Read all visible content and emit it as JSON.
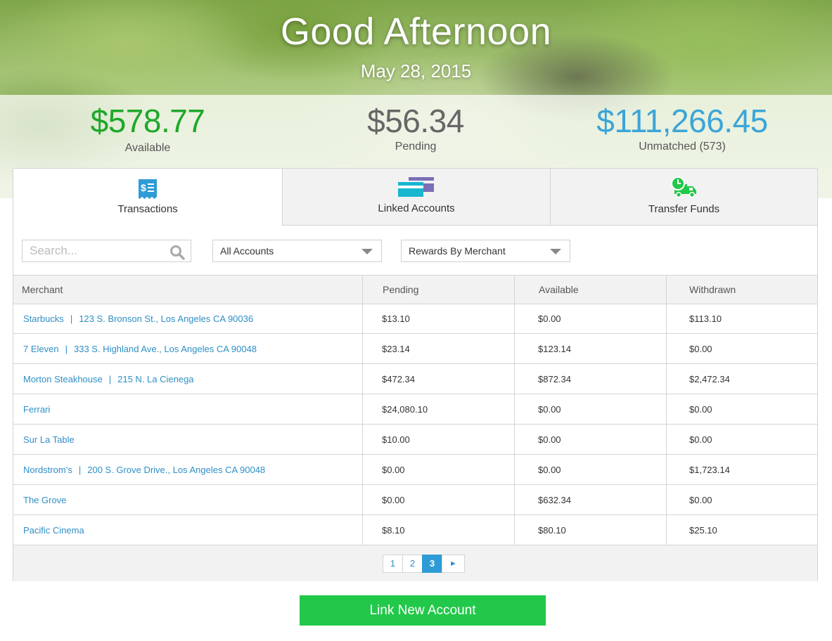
{
  "header": {
    "greeting": "Good Afternoon",
    "date": "May 28, 2015"
  },
  "summary": {
    "available": {
      "amount": "$578.77",
      "label": "Available",
      "color": "#1ea829"
    },
    "pending": {
      "amount": "$56.34",
      "label": "Pending",
      "color": "#666666"
    },
    "unmatched": {
      "amount": "$111,266.45",
      "label": "Unmatched (573)",
      "color": "#3ba5d8"
    }
  },
  "tabs": [
    {
      "label": "Transactions",
      "icon": "receipt-dollar-icon",
      "active": true
    },
    {
      "label": "Linked Accounts",
      "icon": "cards-icon",
      "active": false
    },
    {
      "label": "Transfer Funds",
      "icon": "delivery-truck-clock-icon",
      "active": false
    }
  ],
  "filters": {
    "search_placeholder": "Search...",
    "account_select": "All Accounts",
    "rewards_select": "Rewards By Merchant"
  },
  "table": {
    "columns": [
      "Merchant",
      "Pending",
      "Available",
      "Withdrawn"
    ],
    "rows": [
      {
        "merchant": "Starbucks",
        "address": "123 S. Bronson St., Los Angeles CA 90036",
        "pending": "$13.10",
        "available": "$0.00",
        "withdrawn": "$113.10"
      },
      {
        "merchant": "7 Eleven",
        "address": "333 S. Highland Ave., Los Angeles CA 90048",
        "pending": "$23.14",
        "available": "$123.14",
        "withdrawn": "$0.00"
      },
      {
        "merchant": "Morton Steakhouse",
        "address": "215 N. La Cienega",
        "pending": "$472.34",
        "available": "$872.34",
        "withdrawn": "$2,472.34"
      },
      {
        "merchant": "Ferrari",
        "address": "",
        "pending": "$24,080.10",
        "available": "$0.00",
        "withdrawn": "$0.00"
      },
      {
        "merchant": "Sur La Table",
        "address": "",
        "pending": "$10.00",
        "available": "$0.00",
        "withdrawn": "$0.00"
      },
      {
        "merchant": "Nordstrom’s",
        "address": "200 S. Grove Drive., Los Angeles CA 90048",
        "pending": "$0.00",
        "available": "$0.00",
        "withdrawn": "$1,723.14"
      },
      {
        "merchant": "The Grove",
        "address": "",
        "pending": "$0.00",
        "available": "$632.34",
        "withdrawn": "$0.00"
      },
      {
        "merchant": "Pacific Cinema",
        "address": "",
        "pending": "$8.10",
        "available": "$80.10",
        "withdrawn": "$25.10"
      }
    ]
  },
  "pagination": {
    "pages": [
      "1",
      "2",
      "3"
    ],
    "current": "3",
    "next_glyph": "►"
  },
  "actions": {
    "link_account_label": "Link New Account"
  },
  "colors": {
    "accent_blue": "#2e9bd6",
    "link_blue": "#2e8fc6",
    "button_green": "#22c84a"
  }
}
